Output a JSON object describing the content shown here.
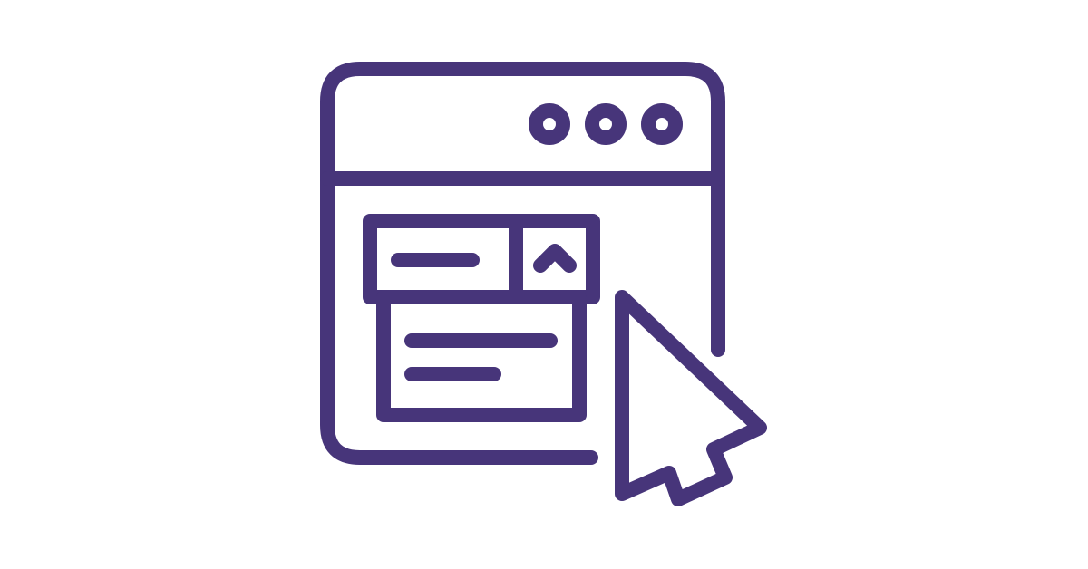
{
  "illustration": {
    "subject": "dropdown-menu-icon",
    "colors": {
      "stroke": "#47357A",
      "background": "#FFFFFF"
    },
    "parts": {
      "window_controls": [
        "window-dot",
        "window-dot",
        "window-dot"
      ],
      "dropdown_toggle_icon": "chevron-up-icon",
      "cursor_icon": "arrow-cursor-icon"
    }
  }
}
